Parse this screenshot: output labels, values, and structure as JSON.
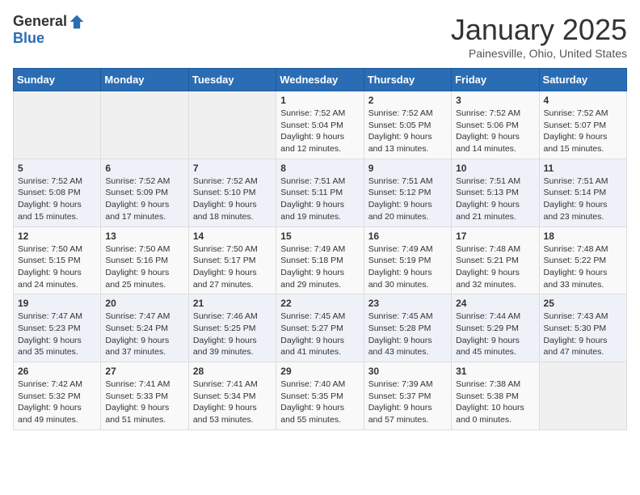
{
  "header": {
    "logo_general": "General",
    "logo_blue": "Blue",
    "month": "January 2025",
    "location": "Painesville, Ohio, United States"
  },
  "weekdays": [
    "Sunday",
    "Monday",
    "Tuesday",
    "Wednesday",
    "Thursday",
    "Friday",
    "Saturday"
  ],
  "weeks": [
    [
      {
        "day": "",
        "info": ""
      },
      {
        "day": "",
        "info": ""
      },
      {
        "day": "",
        "info": ""
      },
      {
        "day": "1",
        "info": "Sunrise: 7:52 AM\nSunset: 5:04 PM\nDaylight: 9 hours\nand 12 minutes."
      },
      {
        "day": "2",
        "info": "Sunrise: 7:52 AM\nSunset: 5:05 PM\nDaylight: 9 hours\nand 13 minutes."
      },
      {
        "day": "3",
        "info": "Sunrise: 7:52 AM\nSunset: 5:06 PM\nDaylight: 9 hours\nand 14 minutes."
      },
      {
        "day": "4",
        "info": "Sunrise: 7:52 AM\nSunset: 5:07 PM\nDaylight: 9 hours\nand 15 minutes."
      }
    ],
    [
      {
        "day": "5",
        "info": "Sunrise: 7:52 AM\nSunset: 5:08 PM\nDaylight: 9 hours\nand 15 minutes."
      },
      {
        "day": "6",
        "info": "Sunrise: 7:52 AM\nSunset: 5:09 PM\nDaylight: 9 hours\nand 17 minutes."
      },
      {
        "day": "7",
        "info": "Sunrise: 7:52 AM\nSunset: 5:10 PM\nDaylight: 9 hours\nand 18 minutes."
      },
      {
        "day": "8",
        "info": "Sunrise: 7:51 AM\nSunset: 5:11 PM\nDaylight: 9 hours\nand 19 minutes."
      },
      {
        "day": "9",
        "info": "Sunrise: 7:51 AM\nSunset: 5:12 PM\nDaylight: 9 hours\nand 20 minutes."
      },
      {
        "day": "10",
        "info": "Sunrise: 7:51 AM\nSunset: 5:13 PM\nDaylight: 9 hours\nand 21 minutes."
      },
      {
        "day": "11",
        "info": "Sunrise: 7:51 AM\nSunset: 5:14 PM\nDaylight: 9 hours\nand 23 minutes."
      }
    ],
    [
      {
        "day": "12",
        "info": "Sunrise: 7:50 AM\nSunset: 5:15 PM\nDaylight: 9 hours\nand 24 minutes."
      },
      {
        "day": "13",
        "info": "Sunrise: 7:50 AM\nSunset: 5:16 PM\nDaylight: 9 hours\nand 25 minutes."
      },
      {
        "day": "14",
        "info": "Sunrise: 7:50 AM\nSunset: 5:17 PM\nDaylight: 9 hours\nand 27 minutes."
      },
      {
        "day": "15",
        "info": "Sunrise: 7:49 AM\nSunset: 5:18 PM\nDaylight: 9 hours\nand 29 minutes."
      },
      {
        "day": "16",
        "info": "Sunrise: 7:49 AM\nSunset: 5:19 PM\nDaylight: 9 hours\nand 30 minutes."
      },
      {
        "day": "17",
        "info": "Sunrise: 7:48 AM\nSunset: 5:21 PM\nDaylight: 9 hours\nand 32 minutes."
      },
      {
        "day": "18",
        "info": "Sunrise: 7:48 AM\nSunset: 5:22 PM\nDaylight: 9 hours\nand 33 minutes."
      }
    ],
    [
      {
        "day": "19",
        "info": "Sunrise: 7:47 AM\nSunset: 5:23 PM\nDaylight: 9 hours\nand 35 minutes."
      },
      {
        "day": "20",
        "info": "Sunrise: 7:47 AM\nSunset: 5:24 PM\nDaylight: 9 hours\nand 37 minutes."
      },
      {
        "day": "21",
        "info": "Sunrise: 7:46 AM\nSunset: 5:25 PM\nDaylight: 9 hours\nand 39 minutes."
      },
      {
        "day": "22",
        "info": "Sunrise: 7:45 AM\nSunset: 5:27 PM\nDaylight: 9 hours\nand 41 minutes."
      },
      {
        "day": "23",
        "info": "Sunrise: 7:45 AM\nSunset: 5:28 PM\nDaylight: 9 hours\nand 43 minutes."
      },
      {
        "day": "24",
        "info": "Sunrise: 7:44 AM\nSunset: 5:29 PM\nDaylight: 9 hours\nand 45 minutes."
      },
      {
        "day": "25",
        "info": "Sunrise: 7:43 AM\nSunset: 5:30 PM\nDaylight: 9 hours\nand 47 minutes."
      }
    ],
    [
      {
        "day": "26",
        "info": "Sunrise: 7:42 AM\nSunset: 5:32 PM\nDaylight: 9 hours\nand 49 minutes."
      },
      {
        "day": "27",
        "info": "Sunrise: 7:41 AM\nSunset: 5:33 PM\nDaylight: 9 hours\nand 51 minutes."
      },
      {
        "day": "28",
        "info": "Sunrise: 7:41 AM\nSunset: 5:34 PM\nDaylight: 9 hours\nand 53 minutes."
      },
      {
        "day": "29",
        "info": "Sunrise: 7:40 AM\nSunset: 5:35 PM\nDaylight: 9 hours\nand 55 minutes."
      },
      {
        "day": "30",
        "info": "Sunrise: 7:39 AM\nSunset: 5:37 PM\nDaylight: 9 hours\nand 57 minutes."
      },
      {
        "day": "31",
        "info": "Sunrise: 7:38 AM\nSunset: 5:38 PM\nDaylight: 10 hours\nand 0 minutes."
      },
      {
        "day": "",
        "info": ""
      }
    ]
  ]
}
